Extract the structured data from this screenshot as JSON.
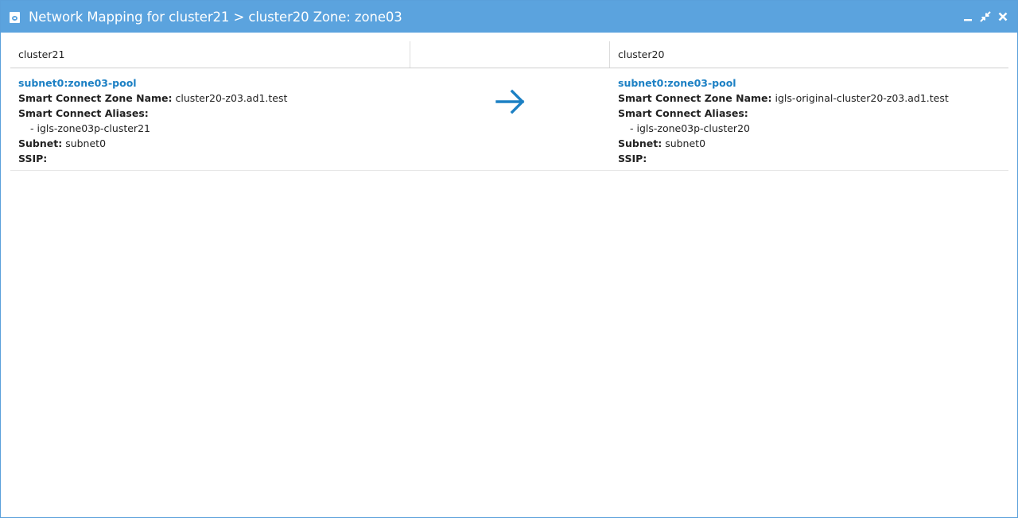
{
  "window": {
    "title": "Network Mapping for cluster21 > cluster20 Zone: zone03",
    "icon": "app-window-icon",
    "controls": [
      "minimize-icon",
      "restore-icon",
      "close-icon"
    ],
    "accent_color": "#5ba3de",
    "link_color": "#1c80c4"
  },
  "table": {
    "headers": {
      "left": "cluster21",
      "middle": "",
      "right": "cluster20"
    },
    "row": {
      "left": {
        "pool": "subnet0:zone03-pool",
        "zone_name_label": "Smart Connect Zone Name:",
        "zone_name_value": "cluster20-z03.ad1.test",
        "aliases_label": "Smart Connect Aliases:",
        "alias": "- igls-zone03p-cluster21",
        "subnet_label": "Subnet:",
        "subnet_value": "subnet0",
        "ssip_label": "SSIP:",
        "ssip_value": ""
      },
      "arrow_icon": "arrow-right-icon",
      "right": {
        "pool": "subnet0:zone03-pool",
        "zone_name_label": "Smart Connect Zone Name:",
        "zone_name_value": "igls-original-cluster20-z03.ad1.test",
        "aliases_label": "Smart Connect Aliases:",
        "alias": "- igls-zone03p-cluster20",
        "subnet_label": "Subnet:",
        "subnet_value": "subnet0",
        "ssip_label": "SSIP:",
        "ssip_value": ""
      }
    }
  }
}
